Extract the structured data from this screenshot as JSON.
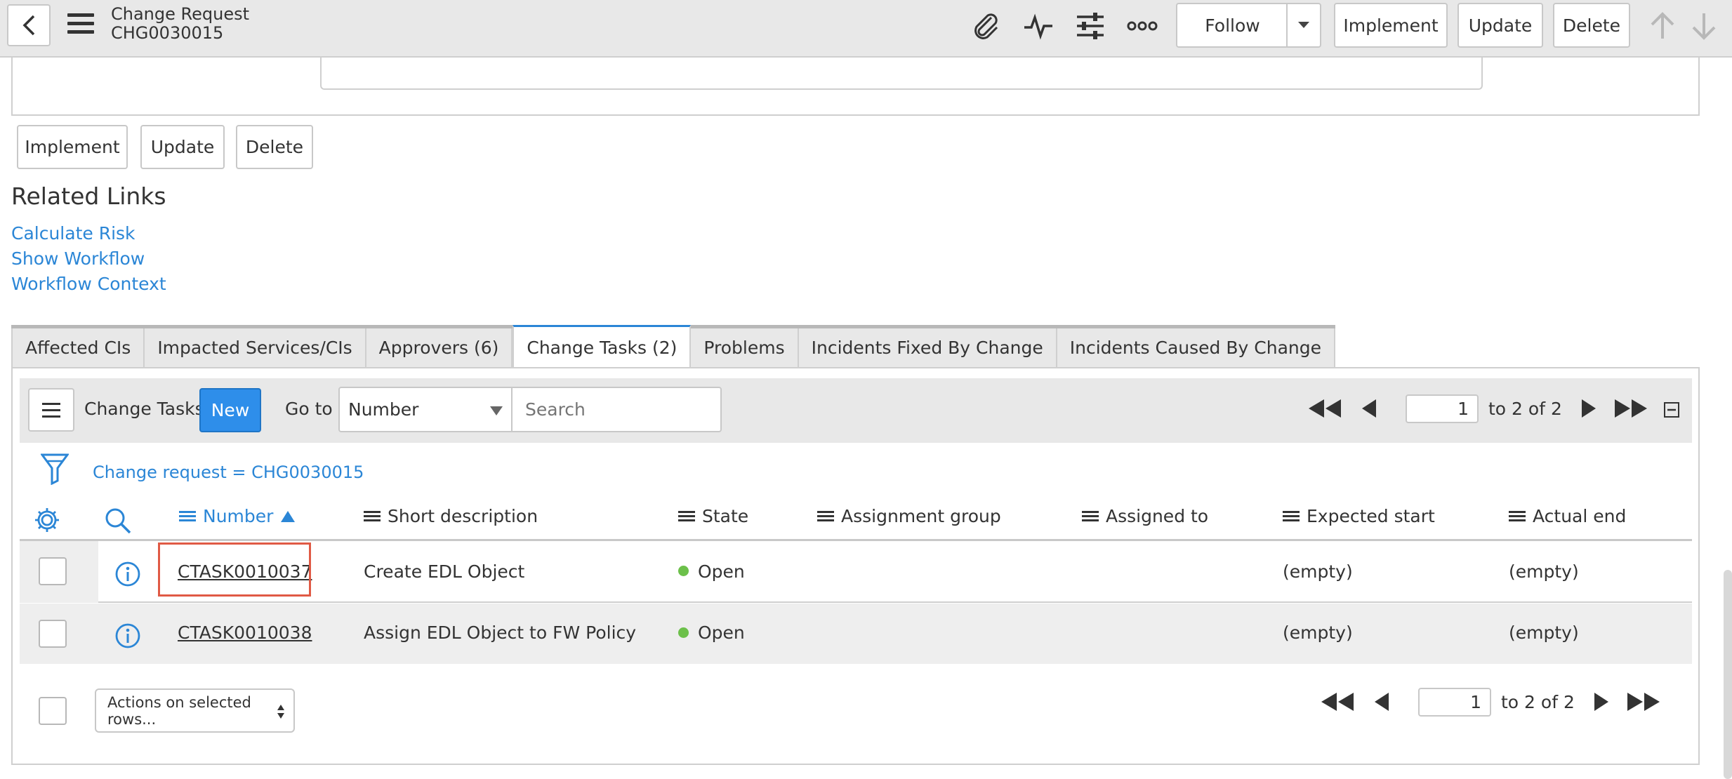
{
  "header": {
    "title": "Change Request",
    "number": "CHG0030015",
    "follow_label": "Follow",
    "implement_label": "Implement",
    "update_label": "Update",
    "delete_label": "Delete",
    "icons": [
      "back-icon",
      "menu-icon",
      "paperclip-icon",
      "activity-icon",
      "sliders-icon",
      "more-icon",
      "arrow-up-icon",
      "arrow-down-icon"
    ]
  },
  "form_buttons": {
    "implement_label": "Implement",
    "update_label": "Update",
    "delete_label": "Delete"
  },
  "related_links": {
    "title": "Related Links",
    "links": [
      "Calculate Risk",
      "Show Workflow",
      "Workflow Context"
    ]
  },
  "tabs": [
    {
      "label": "Affected CIs"
    },
    {
      "label": "Impacted Services/CIs"
    },
    {
      "label": "Approvers (6)"
    },
    {
      "label": "Change Tasks (2)",
      "active": true
    },
    {
      "label": "Problems"
    },
    {
      "label": "Incidents Fixed By Change"
    },
    {
      "label": "Incidents Caused By Change"
    }
  ],
  "list": {
    "title": "Change Tasks",
    "new_label": "New",
    "goto_label": "Go to",
    "goto_field": "Number",
    "search_placeholder": "Search",
    "page": "1",
    "page_range": "to 2 of 2",
    "filter": "Change request = CHG0030015",
    "columns": [
      "Number",
      "Short description",
      "State",
      "Assignment group",
      "Assigned to",
      "Expected start",
      "Actual end"
    ],
    "sorted_column": "Number",
    "rows": [
      {
        "number": "CTASK0010037",
        "short_description": "Create EDL Object",
        "state": "Open",
        "assignment_group": "",
        "assigned_to": "",
        "expected_start": "(empty)",
        "actual_end": "(empty)"
      },
      {
        "number": "CTASK0010038",
        "short_description": "Assign EDL Object to FW Policy",
        "state": "Open",
        "assignment_group": "",
        "assigned_to": "",
        "expected_start": "(empty)",
        "actual_end": "(empty)"
      }
    ],
    "actions_label": "Actions on selected rows...",
    "colors": {
      "accent": "#2b86d6",
      "new_button": "#2e8eea",
      "state_open": "#6cc04a",
      "highlight": "#e05a45"
    }
  }
}
